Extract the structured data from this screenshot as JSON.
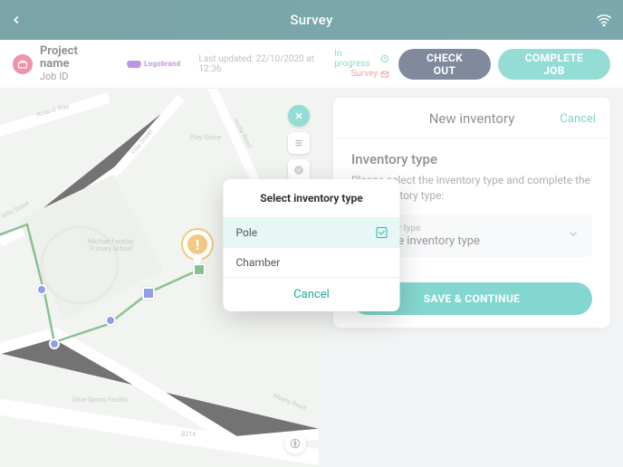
{
  "topbar": {
    "title": "Survey"
  },
  "info": {
    "project_name": "Project name",
    "job_id": "Job ID",
    "brand": "Logobrand",
    "updated": "Last updated: 22/10/2020 at 12:36",
    "status_progress": "In progress",
    "status_survey": "Survey",
    "checkout_label": "CHECK OUT",
    "complete_label": "COMPLETE JOB"
  },
  "panel": {
    "title": "New inventory",
    "cancel": "Cancel",
    "section_title": "Inventory type",
    "section_desc": "Please select the inventory type and complete the new inventory type:",
    "dropdown_label": "Inventory type",
    "dropdown_value": "Choose inventory type",
    "save_label": "SAVE & CONTINUE"
  },
  "modal": {
    "title": "Select inventory type",
    "options": [
      {
        "label": "Pole",
        "selected": true
      },
      {
        "label": "Chamber",
        "selected": false
      }
    ],
    "cancel": "Cancel"
  },
  "map": {
    "labels": {
      "roland_way": "Roland Way",
      "iliffe_street": "Iliffe Street",
      "villa_street": "Villa Street",
      "inville_road": "Inville Road",
      "play_space": "Play Space",
      "school": "Michael Faraday\nPrimary School",
      "sports": "Olive Sports Facility",
      "albany_road": "Albany Road",
      "b214": "B214"
    }
  }
}
